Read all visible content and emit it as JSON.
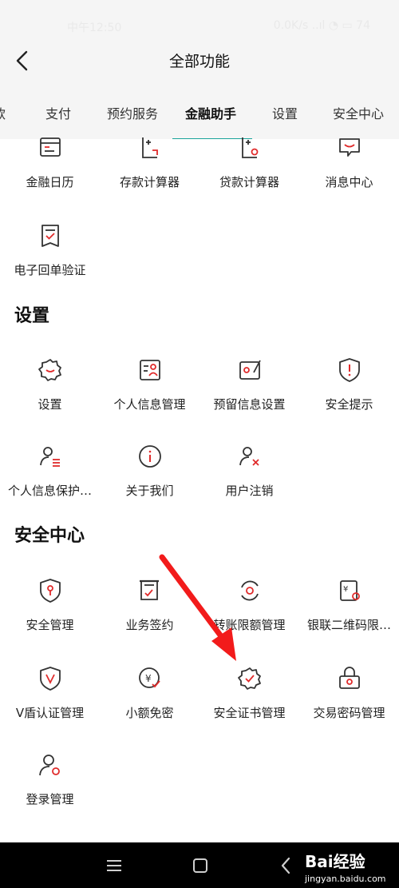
{
  "status_bar": {
    "left": "中午12:50",
    "right": "0.0K/s ..ıl ◔ ▭ 74"
  },
  "header": {
    "title": "全部功能"
  },
  "tabs": [
    {
      "label": "款"
    },
    {
      "label": "支付"
    },
    {
      "label": "预约服务"
    },
    {
      "label": "金融助手"
    },
    {
      "label": "设置"
    },
    {
      "label": "安全中心"
    }
  ],
  "active_tab": "金融助手",
  "finance": {
    "items": [
      {
        "label": "金融日历",
        "icon": "calendar-icon"
      },
      {
        "label": "存款计算器",
        "icon": "deposit-calculator-icon"
      },
      {
        "label": "贷款计算器",
        "icon": "loan-calculator-icon"
      },
      {
        "label": "消息中心",
        "icon": "message-icon"
      },
      {
        "label": "电子回单验证",
        "icon": "receipt-verify-icon"
      }
    ]
  },
  "settings": {
    "title": "设置",
    "items": [
      {
        "label": "设置",
        "icon": "gear-icon"
      },
      {
        "label": "个人信息管理",
        "icon": "profile-card-icon"
      },
      {
        "label": "预留信息设置",
        "icon": "reserved-info-icon"
      },
      {
        "label": "安全提示",
        "icon": "shield-alert-icon"
      },
      {
        "label": "个人信息保护…",
        "icon": "user-list-icon"
      },
      {
        "label": "关于我们",
        "icon": "info-icon"
      },
      {
        "label": "用户注销",
        "icon": "user-remove-icon"
      }
    ]
  },
  "security": {
    "title": "安全中心",
    "items": [
      {
        "label": "安全管理",
        "icon": "shield-key-icon"
      },
      {
        "label": "业务签约",
        "icon": "contract-icon"
      },
      {
        "label": "转账限额管理",
        "icon": "transfer-limit-icon"
      },
      {
        "label": "银联二维码限…",
        "icon": "unionpay-qr-icon"
      },
      {
        "label": "V盾认证管理",
        "icon": "v-shield-icon"
      },
      {
        "label": "小额免密",
        "icon": "small-amount-icon"
      },
      {
        "label": "安全证书管理",
        "icon": "certificate-icon"
      },
      {
        "label": "交易密码管理",
        "icon": "trade-password-icon"
      },
      {
        "label": "登录管理",
        "icon": "login-manage-icon"
      }
    ]
  },
  "watermark": {
    "main": "Bai经验",
    "sub": "jingyan.baidu.com"
  },
  "colors": {
    "accent": "#e02b2b",
    "tab_indicator": "#1aa39a",
    "icon_stroke": "#333333",
    "arrow": "#f21b1b"
  }
}
